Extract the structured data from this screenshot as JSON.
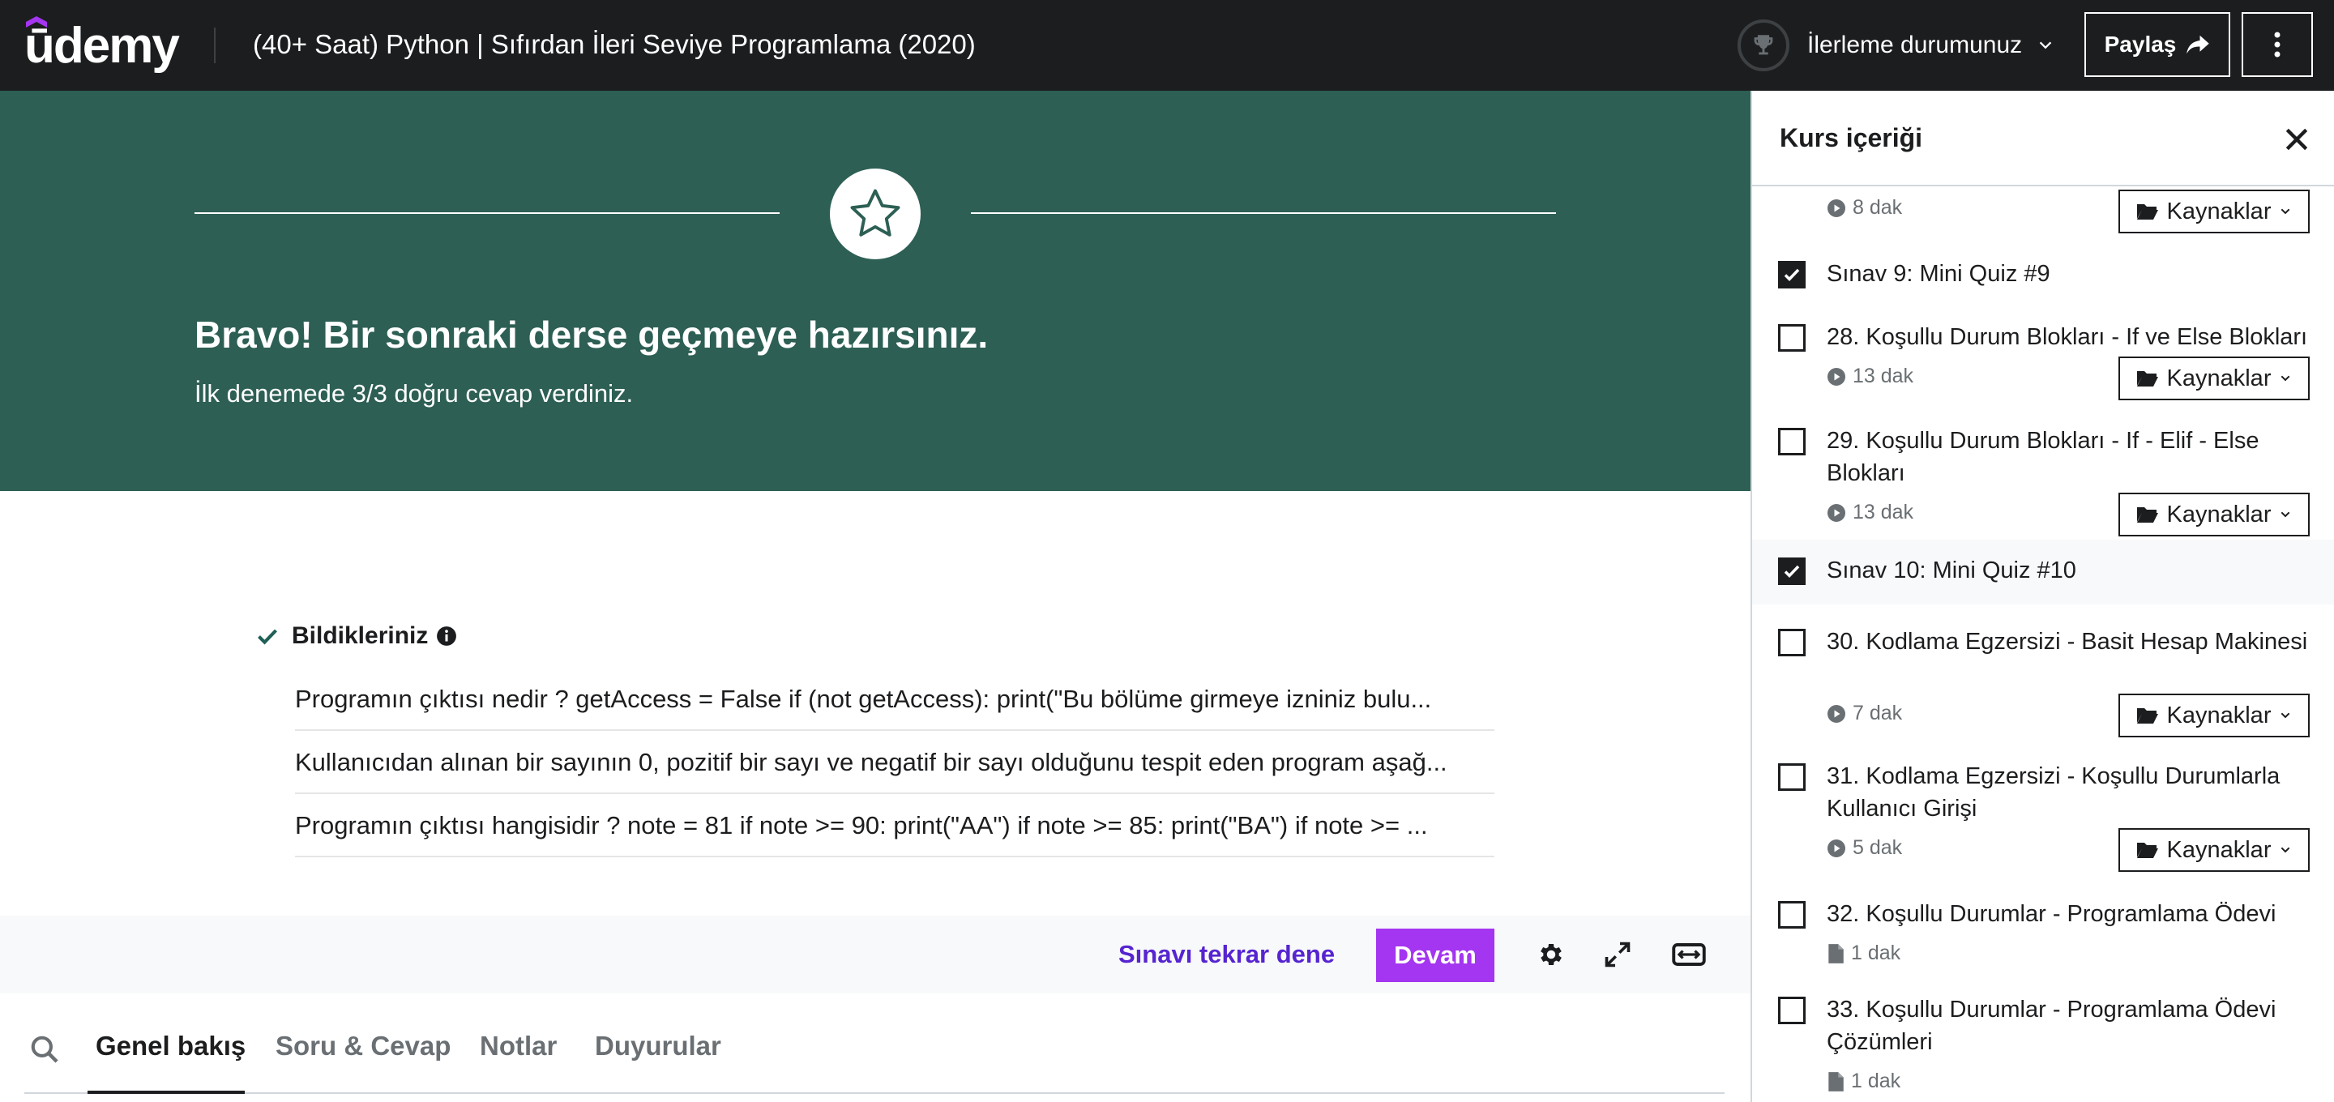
{
  "header": {
    "logo_text": "ūdemy",
    "course_title": "(40+ Saat) Python | Sıfırdan İleri Seviye Programlama (2020)",
    "progress_label": "İlerleme durumunuz",
    "share_label": "Paylaş"
  },
  "hero": {
    "title": "Bravo! Bir sonraki derse geçmeye hazırsınız.",
    "subtitle": "İlk denemede 3/3 doğru cevap verdiniz."
  },
  "results": {
    "known_label": "Bildikleriniz",
    "questions": [
      "Programın çıktısı nedir ? getAccess = False if (not getAccess): print(\"Bu bölüme girmeye izniniz bulu...",
      "Kullanıcıdan alınan bir sayının 0, pozitif bir sayı ve negatif bir sayı olduğunu tespit eden program aşağ...",
      "Programın çıktısı hangisidir ? note = 81 if note >= 90: print(\"AA\") if note >= 85: print(\"BA\") if note >= ..."
    ]
  },
  "controls": {
    "retry_label": "Sınavı tekrar dene",
    "continue_label": "Devam"
  },
  "tabs": [
    "Genel bakış",
    "Soru & Cevap",
    "Notlar",
    "Duyurular"
  ],
  "sidebar": {
    "title": "Kurs içeriği",
    "resources_label": "Kaynaklar",
    "items": [
      {
        "title": "",
        "meta": "8 dak",
        "checked": false,
        "type": "video"
      },
      {
        "title": "Sınav 9: Mini Quiz #9",
        "meta": "",
        "checked": true,
        "type": "quiz"
      },
      {
        "title": "28. Koşullu Durum Blokları - If ve Else Blokları",
        "meta": "13 dak",
        "checked": false,
        "type": "video"
      },
      {
        "title": "29. Koşullu Durum Blokları - If - Elif - Else Blokları",
        "meta": "13 dak",
        "checked": false,
        "type": "video"
      },
      {
        "title": "Sınav 10: Mini Quiz #10",
        "meta": "",
        "checked": true,
        "type": "quiz"
      },
      {
        "title": "30. Kodlama Egzersizi - Basit Hesap Makinesi",
        "meta": "7 dak",
        "checked": false,
        "type": "video"
      },
      {
        "title": "31. Kodlama Egzersizi - Koşullu Durumlarla Kullanıcı Girişi",
        "meta": "5 dak",
        "checked": false,
        "type": "video"
      },
      {
        "title": "32. Koşullu Durumlar - Programlama Ödevi",
        "meta": "1 dak",
        "checked": false,
        "type": "file"
      },
      {
        "title": "33. Koşullu Durumlar - Programlama Ödevi Çözümleri",
        "meta": "1 dak",
        "checked": false,
        "type": "file"
      }
    ]
  },
  "colors": {
    "header_bg": "#1c1d1f",
    "hero_bg": "#2d5f54",
    "accent_purple": "#a435f0",
    "link_purple": "#5624d0",
    "check_green": "#1e6055"
  }
}
